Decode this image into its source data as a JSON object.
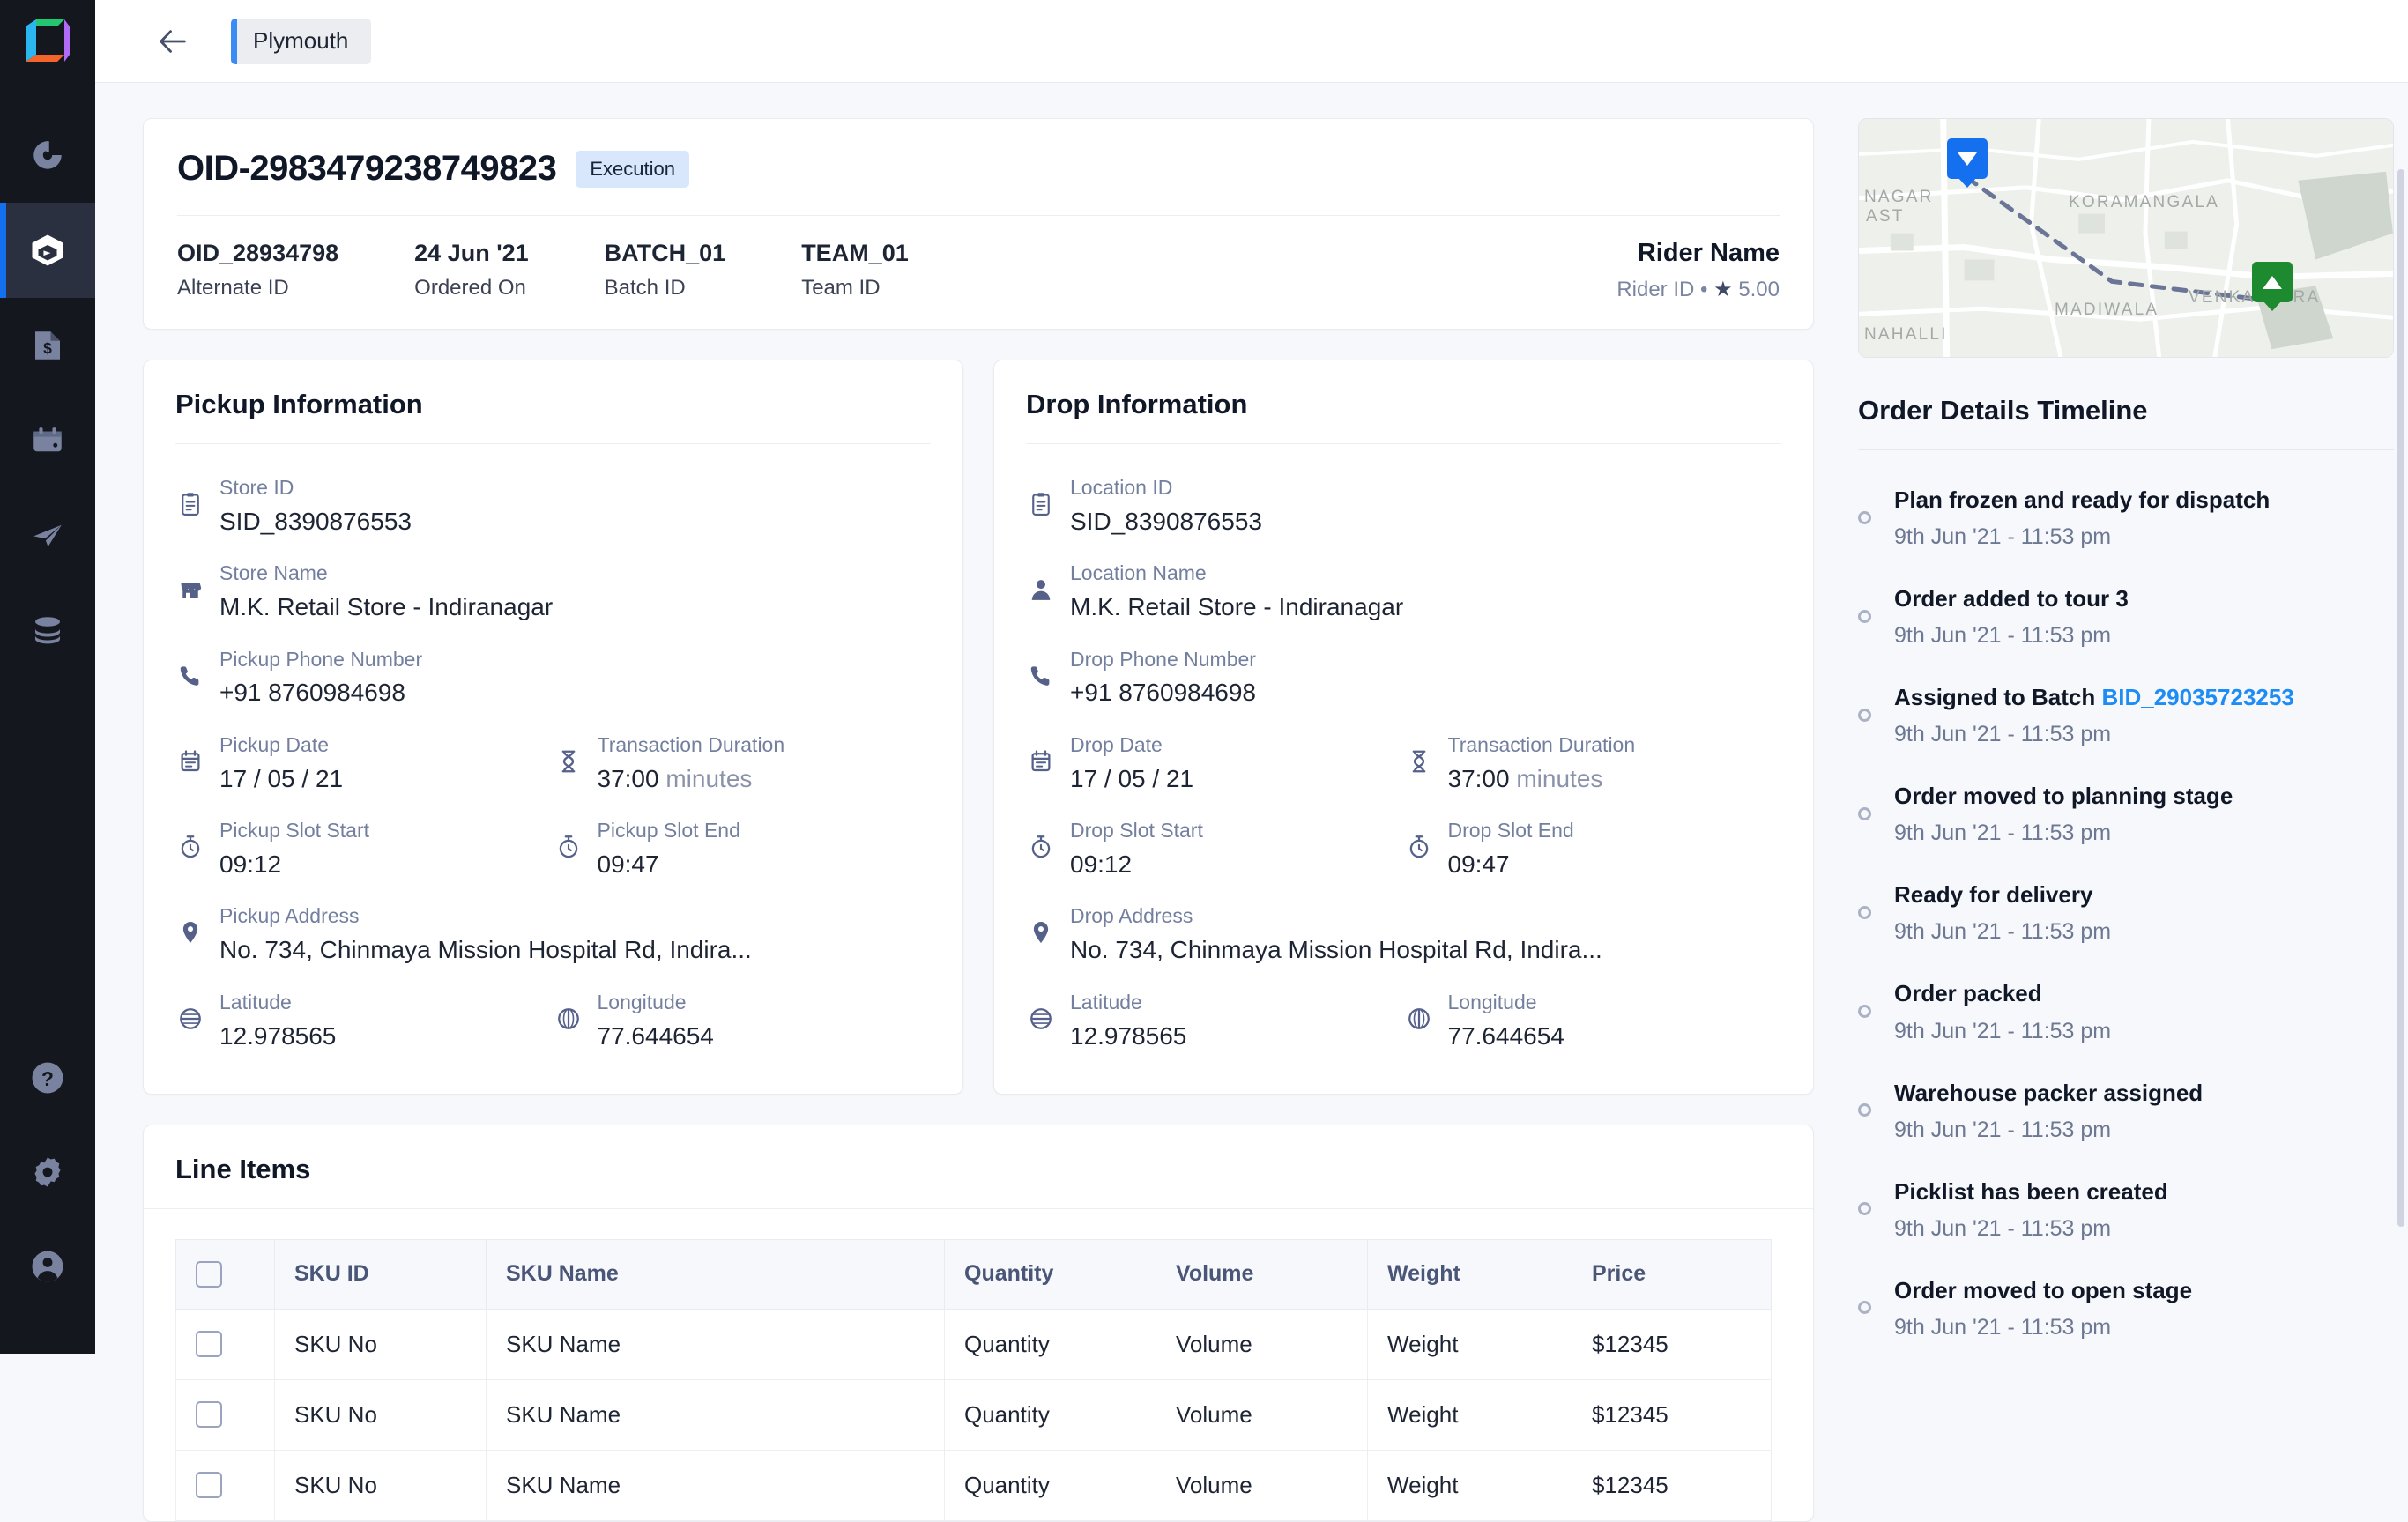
{
  "sidebar": {
    "logo": "cube-logo",
    "top_items": [
      {
        "name": "dashboard-pie-icon",
        "label": "Dashboard"
      },
      {
        "name": "orders-box-icon",
        "label": "Orders",
        "active": true
      },
      {
        "name": "billing-document-icon",
        "label": "Billing"
      },
      {
        "name": "planning-calendar-icon",
        "label": "Planning"
      },
      {
        "name": "dispatch-send-icon",
        "label": "Dispatch"
      },
      {
        "name": "data-layers-icon",
        "label": "Data"
      }
    ],
    "bottom_items": [
      {
        "name": "help-question-icon",
        "label": "Help"
      },
      {
        "name": "settings-gear-icon",
        "label": "Settings"
      },
      {
        "name": "user-account-icon",
        "label": "Account"
      }
    ]
  },
  "topbar": {
    "back_icon": "arrow-left-icon",
    "breadcrumb": "Plymouth"
  },
  "order": {
    "id": "OID-2983479238749823",
    "status": "Execution",
    "meta": [
      {
        "value": "OID_28934798",
        "label": "Alternate ID"
      },
      {
        "value": "24 Jun '21",
        "label": "Ordered On"
      },
      {
        "value": "BATCH_01",
        "label": "Batch ID"
      },
      {
        "value": "TEAM_01",
        "label": "Team ID"
      }
    ],
    "rider": {
      "name": "Rider Name",
      "id_label": "Rider ID",
      "separator": "•",
      "star": "★",
      "rating": "5.00"
    }
  },
  "pickup": {
    "title": "Pickup Information",
    "fields": [
      {
        "icon": "clipboard-icon",
        "label": "Store ID",
        "value": "SID_8390876553",
        "full": true
      },
      {
        "icon": "store-icon",
        "label": "Store Name",
        "value": "M.K. Retail Store - Indiranagar",
        "full": true
      },
      {
        "icon": "phone-icon",
        "label": "Pickup Phone Number",
        "value": "+91 8760984698",
        "full": true
      },
      {
        "icon": "calendar-icon",
        "label": "Pickup Date",
        "value": "17 / 05 / 21"
      },
      {
        "icon": "hourglass-icon",
        "label": "Transaction Duration",
        "value": "37:00",
        "suffix": "minutes"
      },
      {
        "icon": "stopwatch-icon",
        "label": "Pickup Slot Start",
        "value": "09:12"
      },
      {
        "icon": "stopwatch-icon",
        "label": "Pickup Slot End",
        "value": "09:47"
      },
      {
        "icon": "map-pin-icon",
        "label": "Pickup Address",
        "value": "No. 734, Chinmaya Mission Hospital Rd, Indira...",
        "full": true
      },
      {
        "icon": "latitude-icon",
        "label": "Latitude",
        "value": "12.978565"
      },
      {
        "icon": "longitude-icon",
        "label": "Longitude",
        "value": "77.644654"
      }
    ]
  },
  "drop": {
    "title": "Drop Information",
    "fields": [
      {
        "icon": "clipboard-icon",
        "label": "Location ID",
        "value": "SID_8390876553",
        "full": true
      },
      {
        "icon": "person-icon",
        "label": "Location Name",
        "value": "M.K. Retail Store - Indiranagar",
        "full": true
      },
      {
        "icon": "phone-icon",
        "label": "Drop Phone Number",
        "value": "+91 8760984698",
        "full": true
      },
      {
        "icon": "calendar-icon",
        "label": "Drop Date",
        "value": "17 / 05 / 21"
      },
      {
        "icon": "hourglass-icon",
        "label": "Transaction Duration",
        "value": "37:00",
        "suffix": "minutes"
      },
      {
        "icon": "stopwatch-icon",
        "label": "Drop Slot Start",
        "value": "09:12"
      },
      {
        "icon": "stopwatch-icon",
        "label": "Drop Slot End",
        "value": "09:47"
      },
      {
        "icon": "map-pin-icon",
        "label": "Drop Address",
        "value": "No. 734, Chinmaya Mission Hospital Rd, Indira...",
        "full": true
      },
      {
        "icon": "latitude-icon",
        "label": "Latitude",
        "value": "12.978565"
      },
      {
        "icon": "longitude-icon",
        "label": "Longitude",
        "value": "77.644654"
      }
    ]
  },
  "line_items": {
    "title": "Line Items",
    "columns": [
      "",
      "SKU ID",
      "SKU Name",
      "Quantity",
      "Volume",
      "Weight",
      "Price"
    ],
    "rows": [
      {
        "sku_id": "SKU No",
        "sku_name": "SKU Name",
        "quantity": "Quantity",
        "volume": "Volume",
        "weight": "Weight",
        "price": "$12345"
      },
      {
        "sku_id": "SKU No",
        "sku_name": "SKU Name",
        "quantity": "Quantity",
        "volume": "Volume",
        "weight": "Weight",
        "price": "$12345"
      },
      {
        "sku_id": "SKU No",
        "sku_name": "SKU Name",
        "quantity": "Quantity",
        "volume": "Volume",
        "weight": "Weight",
        "price": "$12345"
      }
    ]
  },
  "map": {
    "labels": [
      "NAGAR",
      "AST",
      "KORAMANGALA",
      "MADIWALA",
      "VENKATPURA",
      "NAHALLI"
    ],
    "pickup_pin": "pickup-pin-blue",
    "drop_pin": "drop-pin-green",
    "pickup_color": "#1570ef",
    "drop_color": "#1d8a30"
  },
  "timeline": {
    "title": "Order Details Timeline",
    "items": [
      {
        "text": "Plan frozen and ready for dispatch",
        "date": "9th Jun '21 - 11:53 pm"
      },
      {
        "text": "Order added to tour 3",
        "date": "9th Jun '21 - 11:53 pm"
      },
      {
        "text": "Assigned to Batch ",
        "link": "BID_29035723253",
        "date": "9th Jun '21 - 11:53 pm"
      },
      {
        "text": "Order moved to planning stage",
        "date": "9th Jun '21 - 11:53 pm"
      },
      {
        "text": "Ready for delivery",
        "date": "9th Jun '21 - 11:53 pm"
      },
      {
        "text": "Order packed",
        "date": "9th Jun '21 - 11:53 pm"
      },
      {
        "text": "Warehouse packer assigned",
        "date": "9th Jun '21 - 11:53 pm"
      },
      {
        "text": "Picklist has been created",
        "date": "9th Jun '21 - 11:53 pm"
      },
      {
        "text": "Order moved to open stage",
        "date": "9th Jun '21 - 11:53 pm"
      }
    ]
  },
  "colors": {
    "accent": "#1570ef",
    "sidebar_bg": "#15171e",
    "page_bg": "#f7f8fb",
    "status_pill_bg": "#d8e7fb",
    "link": "#1e8cf5"
  }
}
